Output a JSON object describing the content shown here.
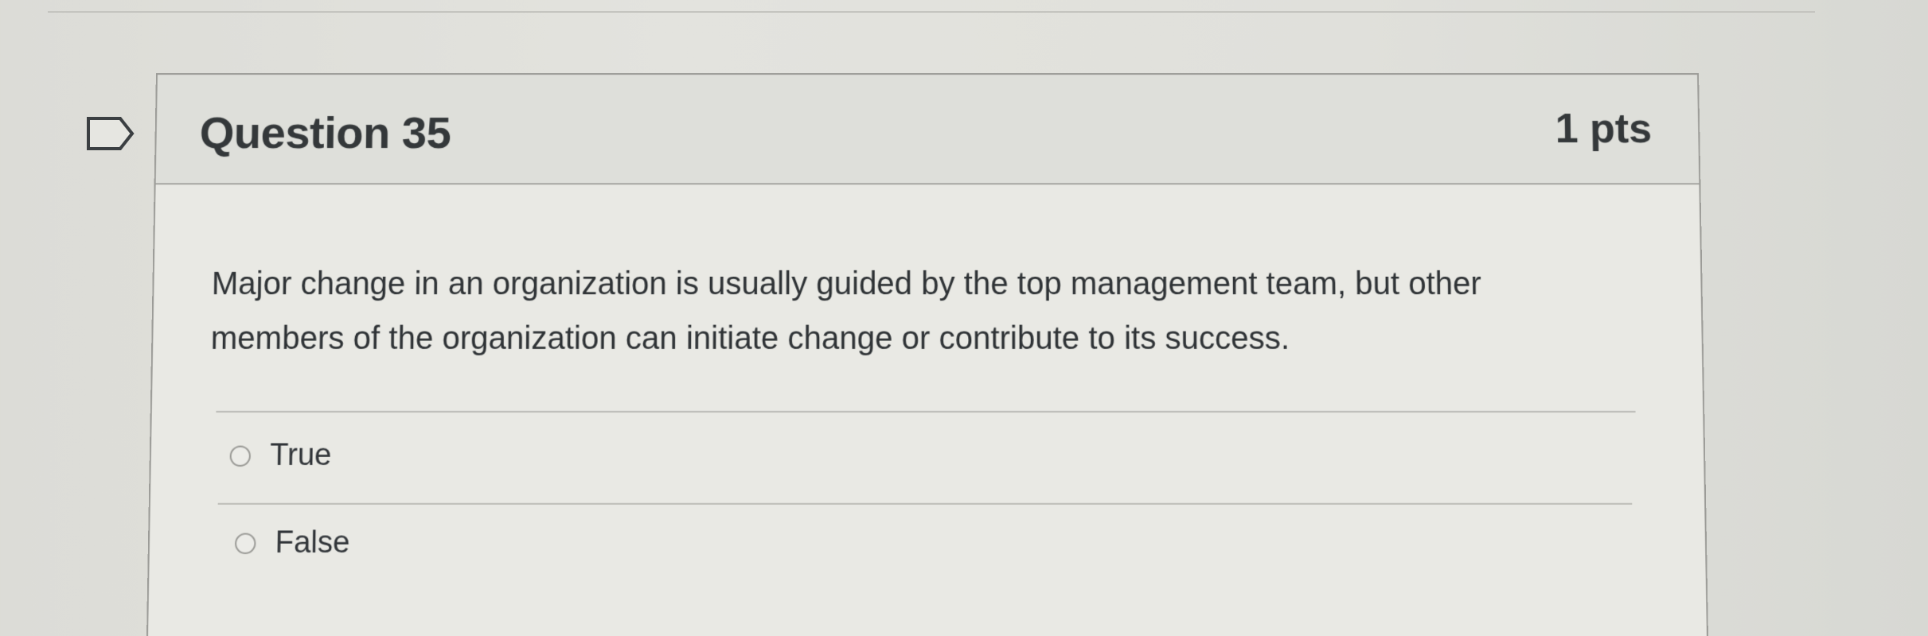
{
  "question": {
    "title": "Question 35",
    "points": "1 pts",
    "text": "Major change in an organization is usually guided by the top management team, but other members of the organization can initiate change or contribute to its success.",
    "flag_icon": "flag-icon"
  },
  "answers": [
    {
      "label": "True",
      "selected": false
    },
    {
      "label": "False",
      "selected": false
    }
  ],
  "colors": {
    "text": "#34383a",
    "border": "#9c9c98",
    "header_bg": "#dedfda",
    "body_bg": "#e9e9e4"
  }
}
